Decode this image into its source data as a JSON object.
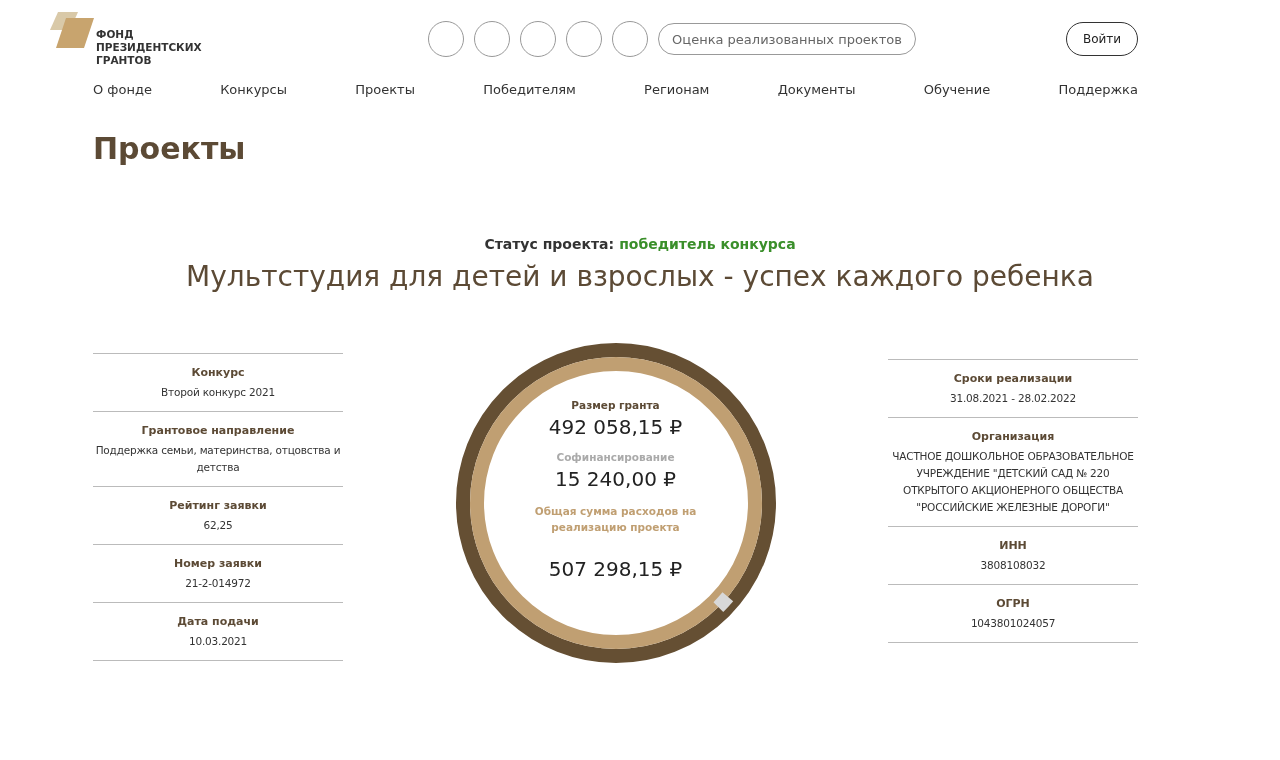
{
  "header": {
    "logo_text": [
      "ФОНД",
      "ПРЕЗИДЕНТСКИХ",
      "ГРАНТОВ"
    ],
    "icon_buttons": [
      {
        "kind": "circle"
      },
      {
        "kind": "circle"
      },
      {
        "kind": "circle"
      },
      {
        "kind": "circle"
      },
      {
        "kind": "circle"
      }
    ],
    "search": {
      "placeholder": "Оценка реализованных проектов"
    },
    "login_button": "Войти"
  },
  "nav": [
    {
      "label": "О фонде"
    },
    {
      "label": "Конкурсы"
    },
    {
      "label": "Проекты"
    },
    {
      "label": "Победителям"
    },
    {
      "label": "Регионам"
    },
    {
      "label": "Документы"
    },
    {
      "label": "Обучение"
    },
    {
      "label": "Поддержка"
    }
  ],
  "page_title": "Проекты",
  "status": {
    "label": "Статус проекта:",
    "value": "победитель конкурса"
  },
  "project_title": "Мультстудия для детей и взрослых - успех каждого ребенка",
  "left_info": [
    {
      "label": "Конкурс",
      "value": "Второй конкурс 2021"
    },
    {
      "label": "Грантовое направление",
      "value": "Поддержка семьи, материнства, отцовства и детства"
    },
    {
      "label": "Рейтинг заявки",
      "value": "62,25"
    },
    {
      "label": "Номер заявки",
      "value": "21-2-014972"
    },
    {
      "label": "Дата подачи",
      "value": "10.03.2021"
    }
  ],
  "finance": [
    {
      "kind": "grant",
      "label": "Размер гранта",
      "value": "492 058,15 ₽"
    },
    {
      "kind": "cofinancing",
      "label": "Софинансирование",
      "value": "15 240,00 ₽"
    },
    {
      "kind": "total",
      "label": "Общая сумма расходов на реализацию проекта",
      "value": "507 298,15 ₽"
    }
  ],
  "right_info": [
    {
      "label": "Сроки реализации",
      "value": "31.08.2021 - 28.02.2022"
    },
    {
      "label": "Организация",
      "value": "ЧАСТНОЕ ДОШКОЛЬНОЕ ОБРАЗОВАТЕЛЬНОЕ УЧРЕЖДЕНИЕ \"ДЕТСКИЙ САД № 220 ОТКРЫТОГО АКЦИОНЕРНОГО ОБЩЕСТВА \"РОССИЙСКИЕ ЖЕЛЕЗНЫЕ ДОРОГИ\""
    },
    {
      "label": "ИНН",
      "value": "3808108032"
    },
    {
      "label": "ОГРН",
      "value": "1043801024057"
    }
  ]
}
